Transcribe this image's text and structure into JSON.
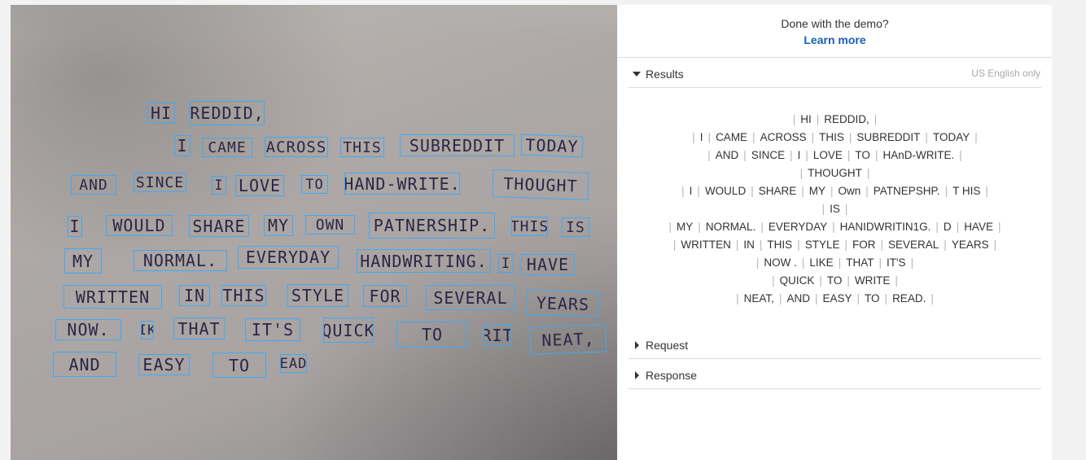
{
  "image": {
    "words": [
      {
        "text": "HI"
      },
      {
        "text": "REDDID,"
      },
      {
        "text": "I"
      },
      {
        "text": "CAME"
      },
      {
        "text": "ACROSS"
      },
      {
        "text": "THIS"
      },
      {
        "text": "SUBREDDIT"
      },
      {
        "text": "TODAY"
      },
      {
        "text": "AND"
      },
      {
        "text": "SINCE"
      },
      {
        "text": "I"
      },
      {
        "text": "LOVE"
      },
      {
        "text": "TO"
      },
      {
        "text": "HAND-WRITE."
      },
      {
        "text": "THOUGHT"
      },
      {
        "text": "I"
      },
      {
        "text": "WOULD"
      },
      {
        "text": "SHARE"
      },
      {
        "text": "MY"
      },
      {
        "text": "OWN"
      },
      {
        "text": "PATNERSHIP."
      },
      {
        "text": "THIS"
      },
      {
        "text": "IS"
      },
      {
        "text": "MY"
      },
      {
        "text": "NORMAL."
      },
      {
        "text": "EVERYDAY"
      },
      {
        "text": "HANDWRITING."
      },
      {
        "text": "I"
      },
      {
        "text": "HAVE"
      },
      {
        "text": "WRITTEN"
      },
      {
        "text": "IN"
      },
      {
        "text": "THIS"
      },
      {
        "text": "STYLE"
      },
      {
        "text": "FOR"
      },
      {
        "text": "SEVERAL"
      },
      {
        "text": "YEARS"
      },
      {
        "text": "NOW."
      },
      {
        "text": "LIKE"
      },
      {
        "text": "THAT"
      },
      {
        "text": "IT'S"
      },
      {
        "text": "QUICK"
      },
      {
        "text": "TO"
      },
      {
        "text": "WRITE"
      },
      {
        "text": "NEAT,"
      },
      {
        "text": "AND"
      },
      {
        "text": "EASY"
      },
      {
        "text": "TO"
      },
      {
        "text": "READ."
      }
    ]
  },
  "panel": {
    "demo_title": "Done with the demo?",
    "learn_more": "Learn more",
    "results_label": "Results",
    "lang_note": "US English only",
    "request_label": "Request",
    "response_label": "Response"
  },
  "results": [
    [
      "HI",
      "REDDID,"
    ],
    [
      "I",
      "CAME",
      "ACROSS",
      "THIS",
      "SUBREDDIT",
      "TODAY"
    ],
    [
      "AND",
      "SINCE",
      "I",
      "LOVE",
      "TO",
      "HAnD-WRITE."
    ],
    [
      "THOUGHT"
    ],
    [
      "I",
      "WOULD",
      "SHARE",
      "MY",
      "Own",
      "PATNEPSHP.",
      "T HIS"
    ],
    [
      "IS"
    ],
    [
      "MY",
      "NORMAL.",
      "EVERYDAY",
      "HANIDWRITIN1G.",
      "D",
      "HAVE"
    ],
    [
      "WRITTEN",
      "IN",
      "THIS",
      "STYLE",
      "FOR",
      "SEVERAL",
      "YEARS"
    ],
    [
      "NOW .",
      "LIKE",
      "THAT",
      "IT'S"
    ],
    [
      "QUICK",
      "TO",
      "WRITE"
    ],
    [
      "NEAT,",
      "AND",
      "EASY",
      "TO",
      "READ."
    ]
  ]
}
